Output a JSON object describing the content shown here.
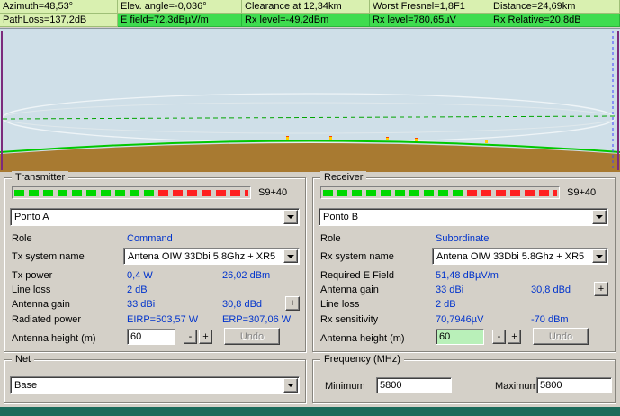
{
  "status": {
    "row1": [
      "Azimuth=48,53°",
      "Elev. angle=-0,036°",
      "Clearance at 12,34km",
      "Worst Fresnel=1,8F1",
      "Distance=24,69km"
    ],
    "row2": [
      "PathLoss=137,2dB",
      "E field=72,3dBµV/m",
      "Rx level=-49,2dBm",
      "Rx level=780,65µV",
      "Rx Relative=20,8dB"
    ]
  },
  "transmitter": {
    "title": "Transmitter",
    "smeter": "S9+40",
    "station": "Ponto A",
    "role_label": "Role",
    "role": "Command",
    "system_label": "Tx system name",
    "system": "Antena OIW 33Dbi 5.8Ghz + XR5",
    "tx_power_label": "Tx power",
    "tx_power_w": "0,4 W",
    "tx_power_dbm": "26,02 dBm",
    "line_loss_label": "Line loss",
    "line_loss": "2 dB",
    "gain_label": "Antenna gain",
    "gain_dbi": "33 dBi",
    "gain_dbd": "30,8 dBd",
    "gain_plus": "+",
    "radiated_label": "Radiated power",
    "eirp": "EIRP=503,57 W",
    "erp": "ERP=307,06 W",
    "height_label": "Antenna height (m)",
    "height": "60",
    "minus": "-",
    "plus": "+",
    "undo": "Undo"
  },
  "receiver": {
    "title": "Receiver",
    "smeter": "S9+40",
    "station": "Ponto B",
    "role_label": "Role",
    "role": "Subordinate",
    "system_label": "Rx system name",
    "system": "Antena OIW 33Dbi 5.8Ghz + XR5",
    "efield_label": "Required E Field",
    "efield": "51,48 dBµV/m",
    "gain_label": "Antenna gain",
    "gain_dbi": "33 dBi",
    "gain_dbd": "30,8 dBd",
    "gain_plus": "+",
    "line_loss_label": "Line loss",
    "line_loss": "2 dB",
    "sens_label": "Rx sensitivity",
    "sens_uv": "70,7946µV",
    "sens_dbm": "-70 dBm",
    "height_label": "Antenna height (m)",
    "height": "60",
    "minus": "-",
    "plus": "+",
    "undo": "Undo"
  },
  "net": {
    "title": "Net",
    "selected": "Base"
  },
  "frequency": {
    "title": "Frequency (MHz)",
    "min_label": "Minimum",
    "min": "5800",
    "max_label": "Maximum",
    "max": "5800"
  },
  "colors": {
    "status_row1_bg": "#d9f0b0",
    "status_row2_bg": "#3fdc4f",
    "value_text": "#0033cc",
    "meter_green": "#00d800",
    "meter_red": "#ff2020",
    "sky": "#cfdfe8",
    "terrain": "#a87a31",
    "vegetation": "#00c800",
    "height_changed_bg": "#b9f0b9",
    "bottom_bar": "#1b6b5b"
  }
}
